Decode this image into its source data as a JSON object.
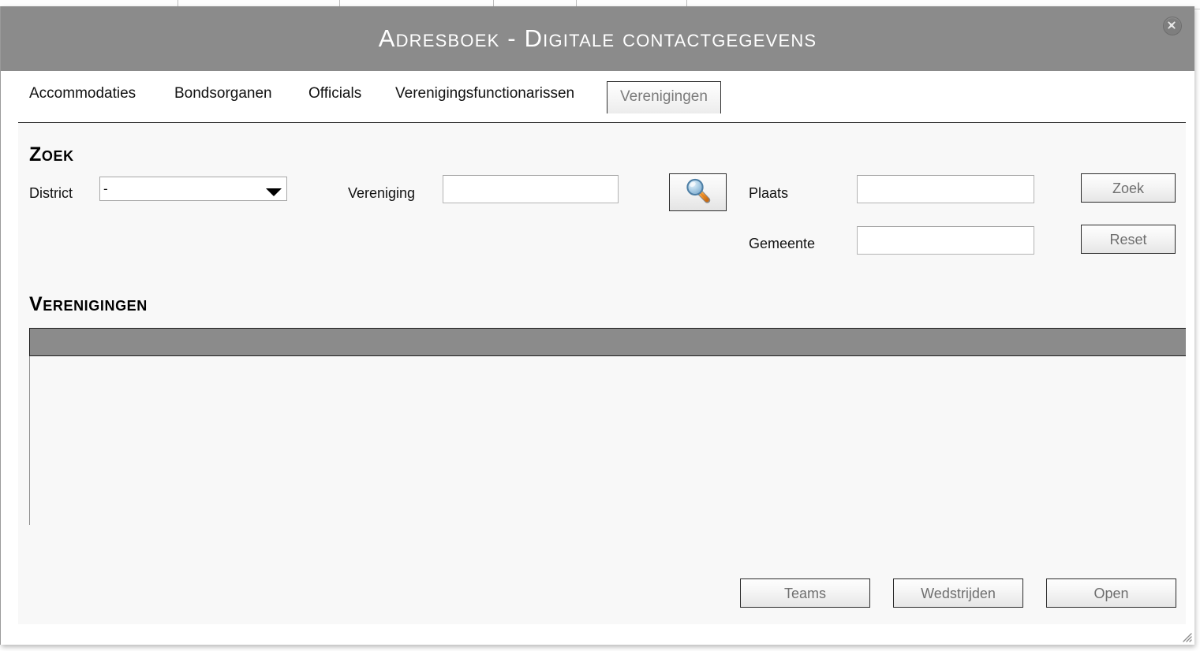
{
  "window": {
    "title": "Adresboek - Digitale contactgegevens",
    "close_icon": "close-icon",
    "resize_grip_icon": "resize-grip-icon"
  },
  "tabs": [
    {
      "label": "Accommodaties",
      "active": false
    },
    {
      "label": "Bondsorganen",
      "active": false
    },
    {
      "label": "Officials",
      "active": false
    },
    {
      "label": "Verenigingsfunctionarissen",
      "active": false
    },
    {
      "label": "Verenigingen",
      "active": true
    }
  ],
  "search": {
    "heading": "Zoek",
    "district": {
      "label": "District",
      "value": "-",
      "options": [
        "-"
      ]
    },
    "vereniging": {
      "label": "Vereniging",
      "value": "",
      "placeholder": ""
    },
    "lookup_button": {
      "icon": "magnifier-icon",
      "title": "Zoek vereniging"
    },
    "plaats": {
      "label": "Plaats",
      "value": "",
      "placeholder": ""
    },
    "gemeente": {
      "label": "Gemeente",
      "value": "",
      "placeholder": ""
    },
    "submit_label": "Zoek",
    "reset_label": "Reset"
  },
  "results": {
    "heading": "Verenigingen",
    "columns": [],
    "rows": [],
    "empty_text": ""
  },
  "actions": {
    "teams_label": "Teams",
    "wedstrijden_label": "Wedstrijden",
    "open_label": "Open"
  },
  "colors": {
    "titlebar": "#8b8b8b",
    "panel": "#f8f8f8",
    "table_header": "#8b8b8b",
    "button_text": "#6f6f6f",
    "magnifier_glass": "#a9cbe4",
    "magnifier_handle": "#f0912a"
  }
}
